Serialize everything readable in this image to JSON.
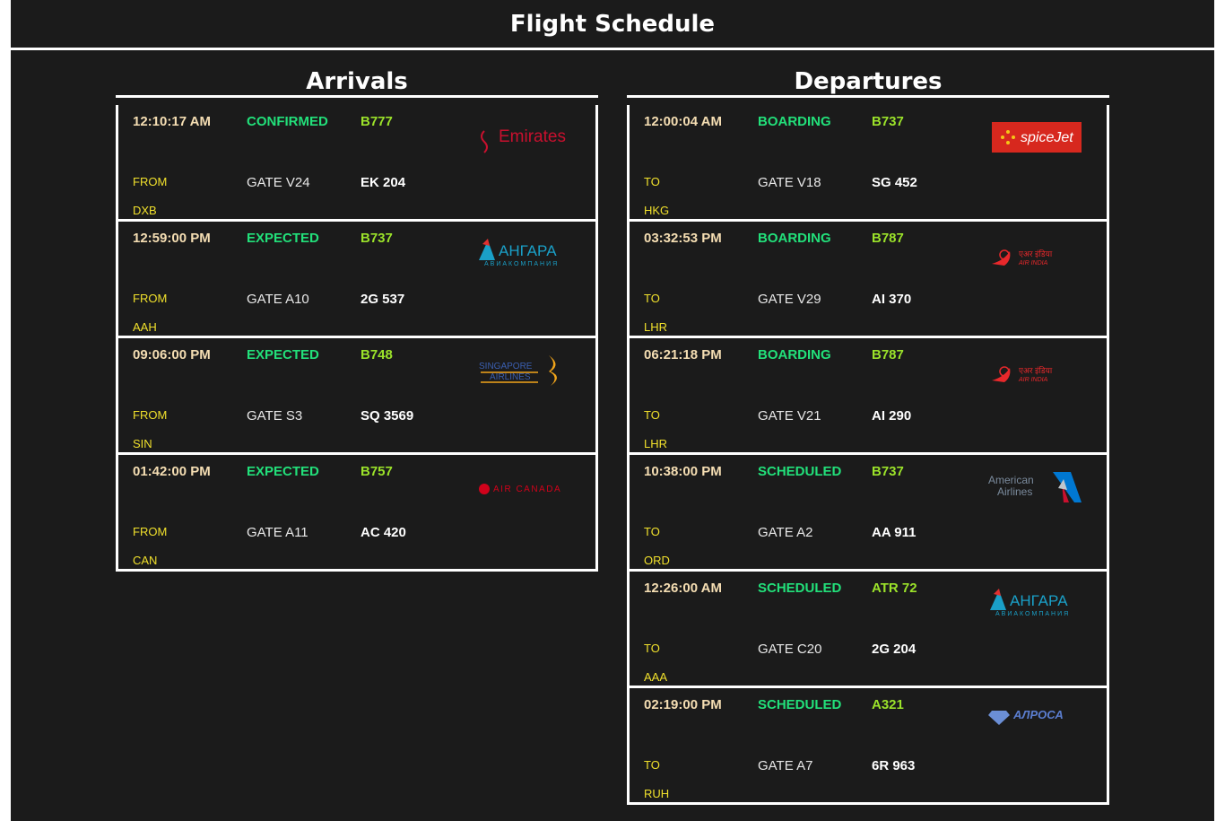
{
  "page": {
    "title": "Flight Schedule"
  },
  "arrivals": {
    "title": "Arrivals",
    "flights": [
      {
        "time": "12:10:17 AM",
        "status": "CONFIRMED",
        "aircraft": "B777",
        "direction": "FROM",
        "airport": "DXB",
        "gate": "GATE V24",
        "flight": "EK 204",
        "airline_logo": "Emirates"
      },
      {
        "time": "12:59:00 PM",
        "status": "EXPECTED",
        "aircraft": "B737",
        "direction": "FROM",
        "airport": "AAH",
        "gate": "GATE A10",
        "flight": "2G 537",
        "airline_logo": "АНГАРА"
      },
      {
        "time": "09:06:00 PM",
        "status": "EXPECTED",
        "aircraft": "B748",
        "direction": "FROM",
        "airport": "SIN",
        "gate": "GATE S3",
        "flight": "SQ 3569",
        "airline_logo": "SINGAPORE AIRLINES"
      },
      {
        "time": "01:42:00 PM",
        "status": "EXPECTED",
        "aircraft": "B757",
        "direction": "FROM",
        "airport": "CAN",
        "gate": "GATE A11",
        "flight": "AC 420",
        "airline_logo": "AIR CANADA"
      }
    ]
  },
  "departures": {
    "title": "Departures",
    "flights": [
      {
        "time": "12:00:04 AM",
        "status": "BOARDING",
        "aircraft": "B737",
        "direction": "TO",
        "airport": "HKG",
        "gate": "GATE V18",
        "flight": "SG 452",
        "airline_logo": "spiceJet"
      },
      {
        "time": "03:32:53 PM",
        "status": "BOARDING",
        "aircraft": "B787",
        "direction": "TO",
        "airport": "LHR",
        "gate": "GATE V29",
        "flight": "AI 370",
        "airline_logo": "AIR INDIA"
      },
      {
        "time": "06:21:18 PM",
        "status": "BOARDING",
        "aircraft": "B787",
        "direction": "TO",
        "airport": "LHR",
        "gate": "GATE V21",
        "flight": "AI 290",
        "airline_logo": "AIR INDIA"
      },
      {
        "time": "10:38:00 PM",
        "status": "SCHEDULED",
        "aircraft": "B737",
        "direction": "TO",
        "airport": "ORD",
        "gate": "GATE A2",
        "flight": "AA 911",
        "airline_logo": "American Airlines"
      },
      {
        "time": "12:26:00 AM",
        "status": "SCHEDULED",
        "aircraft": "ATR 72",
        "direction": "TO",
        "airport": "AAA",
        "gate": "GATE C20",
        "flight": "2G 204",
        "airline_logo": "АНГАРА"
      },
      {
        "time": "02:19:00 PM",
        "status": "SCHEDULED",
        "aircraft": "A321",
        "direction": "TO",
        "airport": "RUH",
        "gate": "GATE A7",
        "flight": "6R 963",
        "airline_logo": "АЛРОСА"
      }
    ]
  },
  "colors": {
    "background": "#1b1b1b",
    "time": "#f5deb3",
    "status": "#22e07a",
    "aircraft": "#9be22a",
    "direction_airport": "#f0e02c",
    "gate": "#e8e8e8",
    "flight_number": "#ffffff"
  }
}
